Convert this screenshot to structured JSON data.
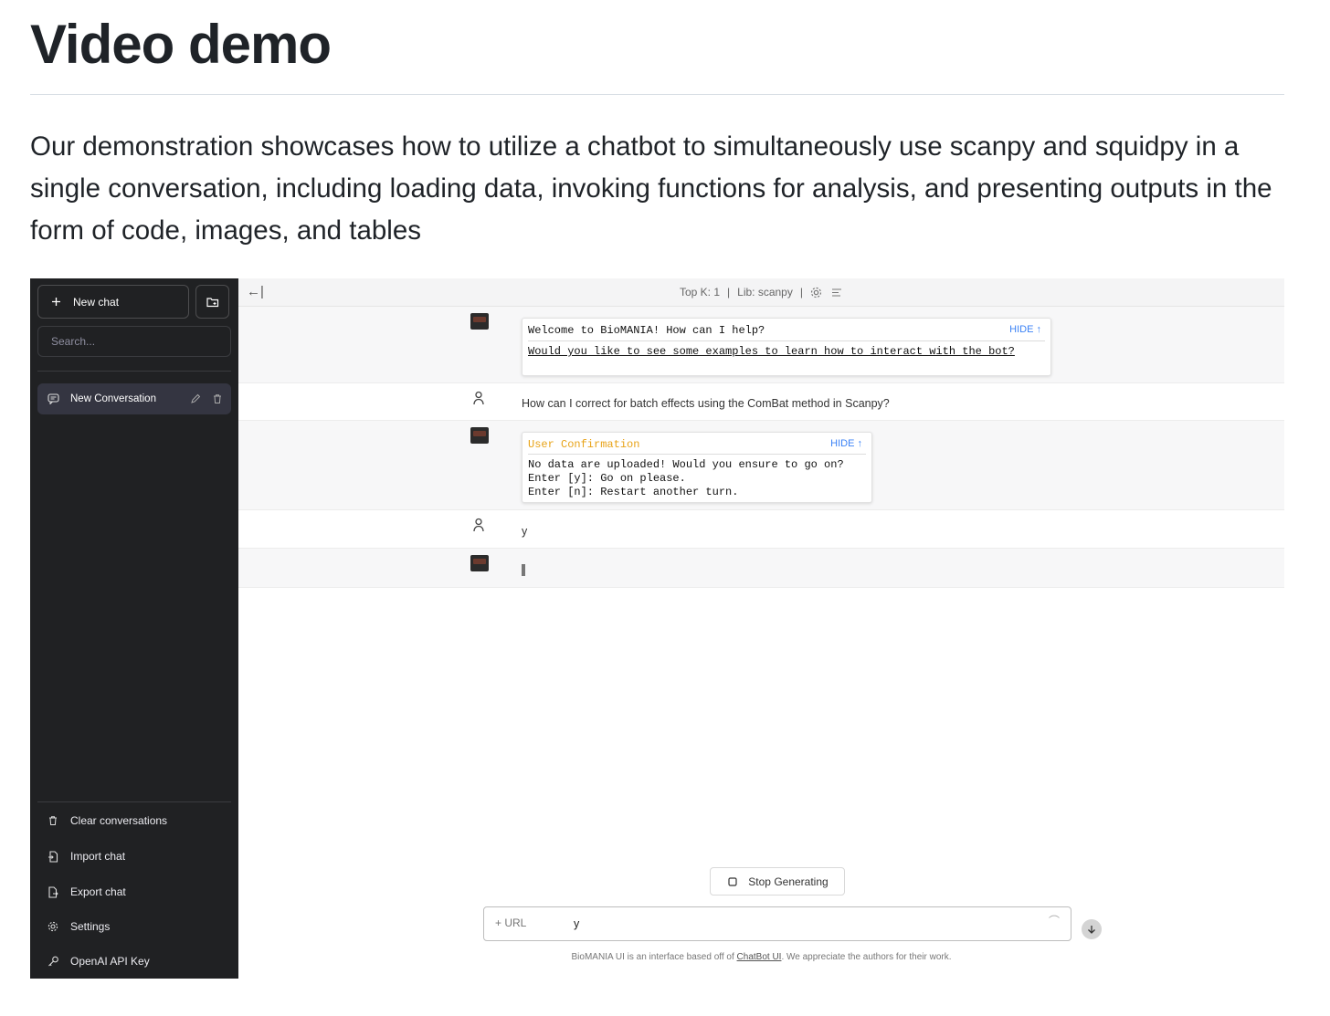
{
  "doc": {
    "title": "Video demo",
    "intro": "Our demonstration showcases how to utilize a chatbot to simultaneously use scanpy and squidpy in a single conversation, including loading data, invoking functions for analysis, and presenting outputs in the form of code, images, and tables"
  },
  "sidebar": {
    "new_chat_label": "New chat",
    "search_placeholder": "Search...",
    "conversation_label": "New Conversation",
    "menu": {
      "clear": "Clear conversations",
      "import": "Import chat",
      "export": "Export chat",
      "settings": "Settings",
      "api_key": "OpenAI API Key"
    }
  },
  "topbar": {
    "collapse_glyph": "←|",
    "status_topk": "Top K: 1",
    "status_sep": "|",
    "status_lib": "Lib: scanpy",
    "status_sep2": "|"
  },
  "messages": {
    "welcome": {
      "title": "Welcome to BioMANIA! How can I help?",
      "hide": "HIDE ↑",
      "link": "Would you like to see some examples to learn how to interact with the bot?"
    },
    "user_question": "How can I correct for batch effects using the ComBat method in Scanpy?",
    "confirmation": {
      "title": "User Confirmation",
      "hide": "HIDE ↑",
      "line1": "No data are uploaded! Would you ensure to go on?",
      "line2": "Enter [y]: Go on please.",
      "line3": "Enter [n]: Restart another turn."
    },
    "user_reply": "y"
  },
  "composer": {
    "stop_label": "Stop Generating",
    "url_label": "+ URL",
    "input_value": "y",
    "footer_prefix": "BioMANIA UI is an interface based off of ",
    "footer_link": "ChatBot UI",
    "footer_suffix": ". We appreciate the authors for their work."
  },
  "colors": {
    "sidebar_bg": "#202123",
    "accent_hide": "#3b82f6",
    "confirm_title": "#e8a317"
  },
  "icons": [
    "plus-icon",
    "folder-plus-icon",
    "chat-bubble-icon",
    "pencil-icon",
    "trash-icon",
    "import-icon",
    "export-icon",
    "gear-icon",
    "key-icon",
    "user-icon",
    "square-icon",
    "arrow-down-icon",
    "menu-lines-icon"
  ]
}
